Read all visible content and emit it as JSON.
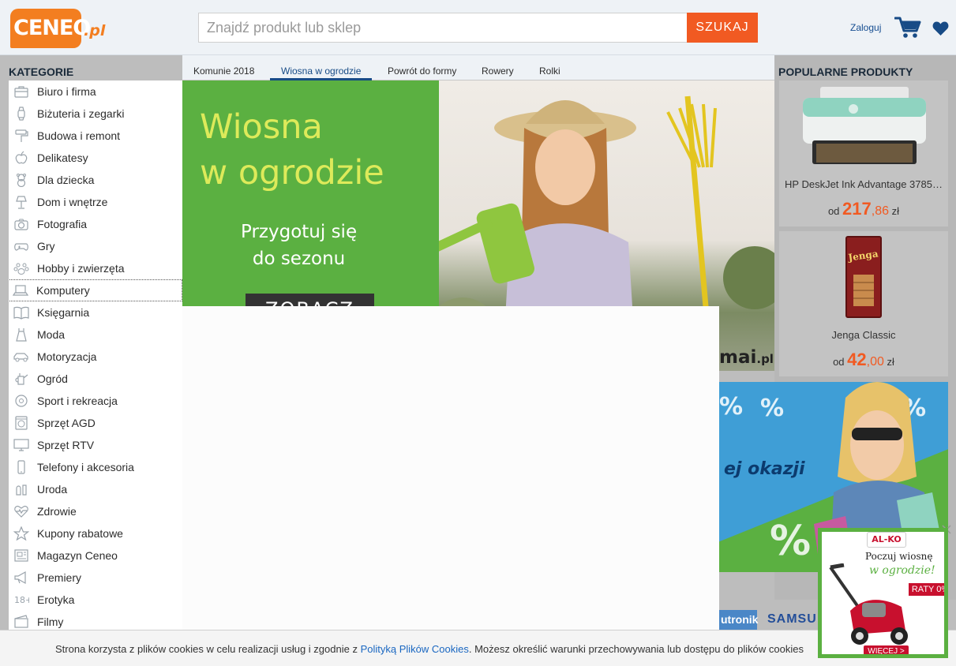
{
  "header": {
    "logo_text": "CENEO",
    "logo_suffix": ".pl",
    "search_placeholder": "Znajdź produkt lub sklep",
    "search_button": "SZUKAJ",
    "login_label": "Zaloguj",
    "cart_icon": "cart-icon",
    "favorites_icon": "heart-icon"
  },
  "categories": {
    "title": "KATEGORIE",
    "items": [
      {
        "label": "Biuro i firma",
        "icon": "briefcase-icon"
      },
      {
        "label": "Biżuteria i zegarki",
        "icon": "watch-icon"
      },
      {
        "label": "Budowa i remont",
        "icon": "paint-roller-icon"
      },
      {
        "label": "Delikatesy",
        "icon": "apple-icon"
      },
      {
        "label": "Dla dziecka",
        "icon": "teddy-bear-icon"
      },
      {
        "label": "Dom i wnętrze",
        "icon": "lamp-icon"
      },
      {
        "label": "Fotografia",
        "icon": "camera-icon"
      },
      {
        "label": "Gry",
        "icon": "gamepad-icon"
      },
      {
        "label": "Hobby i zwierzęta",
        "icon": "paw-icon"
      },
      {
        "label": "Komputery",
        "icon": "laptop-icon"
      },
      {
        "label": "Księgarnia",
        "icon": "book-icon"
      },
      {
        "label": "Moda",
        "icon": "dress-icon"
      },
      {
        "label": "Motoryzacja",
        "icon": "car-icon"
      },
      {
        "label": "Ogród",
        "icon": "watering-can-icon"
      },
      {
        "label": "Sport i rekreacja",
        "icon": "ball-icon"
      },
      {
        "label": "Sprzęt AGD",
        "icon": "washing-machine-icon"
      },
      {
        "label": "Sprzęt RTV",
        "icon": "tv-icon"
      },
      {
        "label": "Telefony i akcesoria",
        "icon": "phone-icon"
      },
      {
        "label": "Uroda",
        "icon": "cosmetics-icon"
      },
      {
        "label": "Zdrowie",
        "icon": "heartbeat-icon"
      },
      {
        "label": "Kupony rabatowe",
        "icon": "star-icon"
      },
      {
        "label": "Magazyn Ceneo",
        "icon": "newspaper-icon"
      },
      {
        "label": "Premiery",
        "icon": "megaphone-icon"
      },
      {
        "label": "Erotyka",
        "icon": "adult-18-icon"
      },
      {
        "label": "Filmy",
        "icon": "film-icon"
      }
    ],
    "hovered_item": "Komputery"
  },
  "tabs": [
    {
      "label": "Komunie 2018"
    },
    {
      "label": "Wiosna w ogrodzie",
      "active": true
    },
    {
      "label": "Powrót do formy"
    },
    {
      "label": "Rowery"
    },
    {
      "label": "Rolki"
    }
  ],
  "hero": {
    "headline_1": "Wiosna",
    "headline_2": "w ogrodzie",
    "sub_1": "Przygotuj się",
    "sub_2": "do sezonu",
    "cta": "ZOBACZ",
    "brand": "mai",
    "brand_suffix": ".pl"
  },
  "popular": {
    "title": "POPULARNE PRODUKTY",
    "products": [
      {
        "name": "HP DeskJet Ink Advantage 3785…",
        "price_prefix": "od",
        "price_int": "217",
        "price_dec": ",86",
        "currency": "zł"
      },
      {
        "name": "Jenga Classic",
        "price_prefix": "od",
        "price_int": "42",
        "price_dec": ",00",
        "currency": "zł"
      }
    ]
  },
  "promo_ad": {
    "text": "ej okazji",
    "percent": "%"
  },
  "brands": {
    "a": "utronik",
    "b": "SAMSU"
  },
  "alko_ad": {
    "logo": "AL-KO",
    "line1": "Poczuj wiosnę",
    "line2": "w ogrodzie!",
    "raty": "RATY 0%",
    "more": "WIĘCEJ >"
  },
  "cookie": {
    "text_before": "Strona korzysta z plików cookies w celu realizacji usług i zgodnie z ",
    "link": "Polityką Plików Cookies",
    "text_after": ". Możesz określić warunki przechowywania lub dostępu do plików cookies"
  },
  "colors": {
    "accent_orange": "#f15a22",
    "nav_blue": "#174b86",
    "green": "#5bb041"
  }
}
